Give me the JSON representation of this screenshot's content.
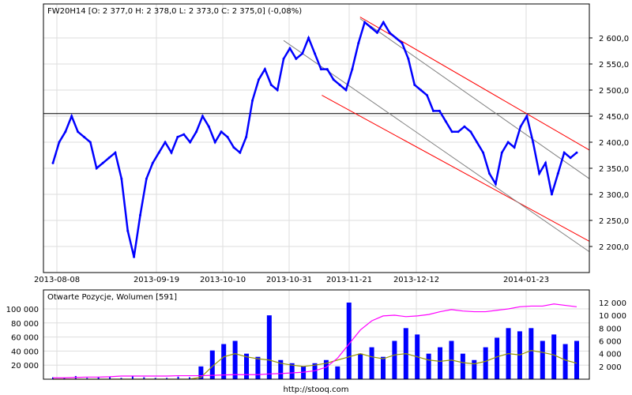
{
  "chart_data": [
    {
      "type": "line",
      "title": "FW20H14 [O: 2 377,0  H: 2 378,0  L: 2 373,0  C: 2 375,0] (-0,08%)",
      "x_tick_labels": [
        "2013-08-08",
        "2013-09-19",
        "2013-10-10",
        "2013-10-31",
        "2013-11-21",
        "2013-12-12",
        "2014-01-23"
      ],
      "y_tick_labels": [
        "2 600,0",
        "2 550,0",
        "2 500,0",
        "2 450,0",
        "2 400,0",
        "2 350,0",
        "2 300,0",
        "2 250,0",
        "2 200,0"
      ],
      "y_ticks": [
        2600,
        2550,
        2500,
        2450,
        2400,
        2350,
        2300,
        2250,
        2200
      ],
      "ylim": [
        2160,
        2670
      ],
      "grid": true,
      "horizontal_line": 2455,
      "series": [
        {
          "name": "FW20H14",
          "color": "#0000ff",
          "values": [
            2360,
            2400,
            2420,
            2450,
            2420,
            2410,
            2400,
            2350,
            2360,
            2370,
            2380,
            2330,
            2230,
            2180,
            2260,
            2330,
            2360,
            2380,
            2400,
            2380,
            2410,
            2415,
            2400,
            2420,
            2450,
            2430,
            2400,
            2420,
            2410,
            2390,
            2380,
            2410,
            2480,
            2520,
            2540,
            2510,
            2500,
            2560,
            2580,
            2560,
            2570,
            2600,
            2570,
            2540,
            2540,
            2520,
            2510,
            2500,
            2540,
            2590,
            2630,
            2620,
            2610,
            2630,
            2610,
            2600,
            2590,
            2560,
            2510,
            2500,
            2490,
            2460,
            2460,
            2440,
            2420,
            2420,
            2430,
            2420,
            2400,
            2380,
            2340,
            2320,
            2380,
            2400,
            2390,
            2430,
            2450,
            2400,
            2340,
            2360,
            2300,
            2340,
            2380,
            2370,
            2380
          ]
        }
      ],
      "trend_lines": [
        {
          "color": "#ff0000",
          "from": [
            0.58,
            2640
          ],
          "to": [
            1.0,
            2385
          ]
        },
        {
          "color": "#ff0000",
          "from": [
            0.51,
            2490
          ],
          "to": [
            1.0,
            2210
          ]
        },
        {
          "color": "#808080",
          "from": [
            0.44,
            2595
          ],
          "to": [
            1.0,
            2190
          ]
        },
        {
          "color": "#808080",
          "from": [
            0.58,
            2637
          ],
          "to": [
            1.0,
            2330
          ]
        }
      ]
    },
    {
      "type": "bar",
      "title": "Otwarte Pozycje, Wolumen [591]",
      "left_axis_labels": [
        "100 000",
        "80 000",
        "60 000",
        "40 000",
        "20 000"
      ],
      "left_ticks": [
        100000,
        80000,
        60000,
        40000,
        20000
      ],
      "left_ylim": [
        0,
        108000
      ],
      "right_axis_labels": [
        "12 000",
        "10 000",
        "8 000",
        "6 000",
        "4 000",
        "2 000"
      ],
      "right_ticks": [
        12000,
        10000,
        8000,
        6000,
        4000,
        2000
      ],
      "right_ylim": [
        0,
        13000
      ],
      "open_interest": [
        2000,
        2000,
        2500,
        3000,
        3000,
        3500,
        4500,
        4500,
        4500,
        4500,
        4500,
        5000,
        5000,
        5000,
        5500,
        6000,
        6500,
        6500,
        6500,
        7500,
        8000,
        9000,
        10000,
        12000,
        17000,
        30000,
        50000,
        70000,
        83000,
        90000,
        91000,
        89000,
        90000,
        92000,
        96000,
        99000,
        97000,
        96000,
        96000,
        98000,
        100000,
        103000,
        104000,
        104000,
        107000,
        105000,
        103000
      ],
      "volume": [
        300,
        200,
        500,
        200,
        300,
        400,
        200,
        500,
        300,
        200,
        200,
        400,
        300,
        2000,
        4500,
        5500,
        6000,
        4000,
        3500,
        10000,
        3000,
        2500,
        2000,
        2500,
        3000,
        2000,
        12000,
        4000,
        5000,
        3500,
        6000,
        8000,
        7000,
        4000,
        5000,
        6000,
        4000,
        3000,
        5000,
        6500,
        8000,
        7500,
        8000,
        6000,
        7000,
        5500,
        6000
      ],
      "volume_avg": [
        0,
        0,
        0,
        0,
        0,
        0,
        0,
        0,
        0,
        0,
        0,
        0,
        0,
        300,
        2000,
        3500,
        4000,
        3500,
        3200,
        3000,
        2500,
        2200,
        2000,
        2200,
        2500,
        3000,
        3500,
        4000,
        3500,
        3200,
        3800,
        4000,
        3500,
        3000,
        2800,
        3000,
        2600,
        2400,
        2800,
        3500,
        4000,
        3800,
        4500,
        4200,
        3800,
        3000,
        2500
      ]
    }
  ],
  "footer": "http://stooq.com"
}
